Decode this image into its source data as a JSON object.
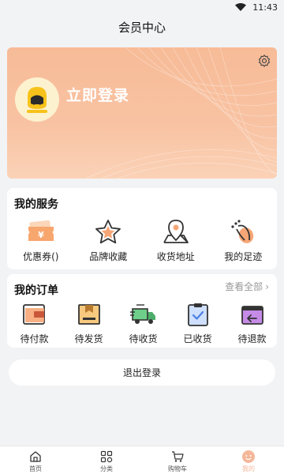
{
  "status": {
    "time": "11:43"
  },
  "header": {
    "title": "会员中心"
  },
  "profile": {
    "login_label": "立即登录"
  },
  "services": {
    "title": "我的服务",
    "items": [
      {
        "label": "优惠券()",
        "icon": "coupon-icon"
      },
      {
        "label": "品牌收藏",
        "icon": "star-icon"
      },
      {
        "label": "收货地址",
        "icon": "location-icon"
      },
      {
        "label": "我的足迹",
        "icon": "footprint-icon"
      }
    ]
  },
  "orders": {
    "title": "我的订单",
    "view_all": "查看全部",
    "items": [
      {
        "label": "待付款",
        "icon": "wallet-icon"
      },
      {
        "label": "待发货",
        "icon": "package-icon"
      },
      {
        "label": "待收货",
        "icon": "truck-icon"
      },
      {
        "label": "已收货",
        "icon": "clipboard-check-icon"
      },
      {
        "label": "待退款",
        "icon": "refund-icon"
      }
    ]
  },
  "logout": {
    "label": "退出登录"
  },
  "tabbar": {
    "items": [
      {
        "label": "首页",
        "icon": "home-icon"
      },
      {
        "label": "分类",
        "icon": "category-icon"
      },
      {
        "label": "购物车",
        "icon": "cart-icon"
      },
      {
        "label": "我的",
        "icon": "profile-face-icon",
        "active": true
      }
    ]
  },
  "colors": {
    "accent": "#f4b79a",
    "hero_bg": "#f8c0a0",
    "avatar_bg": "#fdf2d0"
  }
}
